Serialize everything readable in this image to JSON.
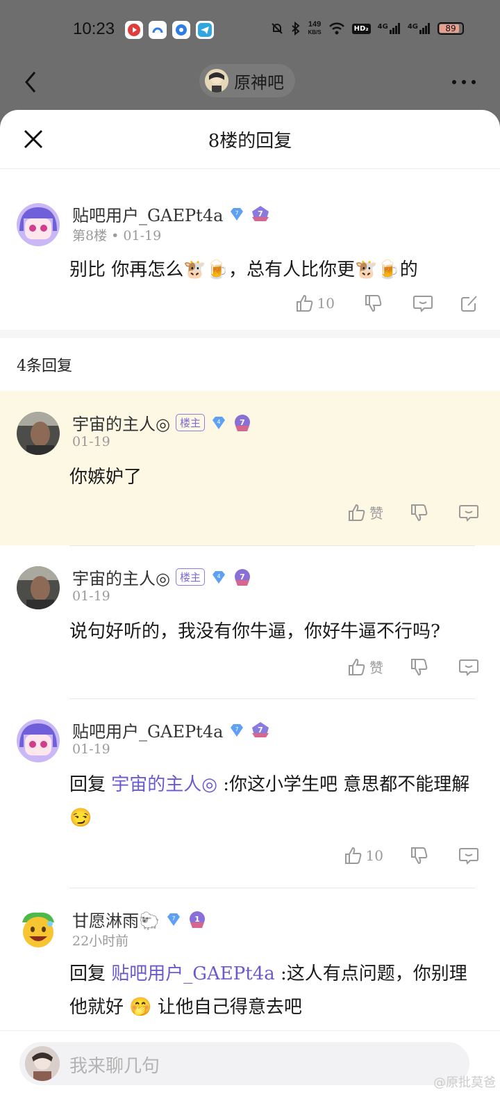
{
  "status_bar": {
    "time": "10:23",
    "net_speed_value": "149",
    "net_speed_unit": "KB/S",
    "hd_label": "HD₂",
    "net1": "4G",
    "net2": "4G",
    "battery": 89,
    "battery_label": "89",
    "app_icons": [
      "red-video-app-icon",
      "blue-cloud-app-icon",
      "blue-circle-app-icon",
      "telegram-icon"
    ]
  },
  "top_bar": {
    "forum_name": "原神吧"
  },
  "sheet": {
    "title": "8楼的回复"
  },
  "main_post": {
    "username": "贴吧用户_GAEPt4a",
    "gem_level": "7",
    "floor": "第8楼",
    "date": "01-19",
    "text": "别比  你再怎么🐮🍺，总有人比你更🐮🍺的",
    "like_count": "10"
  },
  "replies_header": "4条回复",
  "replies": [
    {
      "username": "宇宙的主人◎",
      "owner_tag": "楼主",
      "gem_level": "4",
      "level": "7",
      "date": "01-19",
      "text": "你嫉妒了",
      "like_label": "赞",
      "highlighted": true
    },
    {
      "username": "宇宙的主人◎",
      "owner_tag": "楼主",
      "gem_level": "4",
      "level": "7",
      "date": "01-19",
      "text": "说句好听的，我没有你牛逼，你好牛逼不行吗?",
      "like_label": "赞"
    },
    {
      "username": "贴吧用户_GAEPt4a",
      "gem_level": "7",
      "date": "01-19",
      "reply_prefix": "回复 ",
      "mention": "宇宙的主人◎",
      "text": "  :你这小学生吧  意思都不能理解 😏",
      "like_label": "10"
    },
    {
      "username": "甘愿淋雨🐑",
      "gem_level": "7",
      "level": "1",
      "date": "22小时前",
      "reply_prefix": "回复 ",
      "mention": "贴吧用户_GAEPt4a",
      "text": "  :这人有点问题，你别理他就好 🤭 让他自己得意去吧"
    }
  ],
  "input": {
    "placeholder": "我来聊几句"
  },
  "watermark": "@原批莫爸",
  "colors": {
    "highlight_bg": "#fdf8e4",
    "mention": "#6a5acd",
    "gem": "#5ea0f5",
    "level_badge": "#8a6fd6"
  }
}
